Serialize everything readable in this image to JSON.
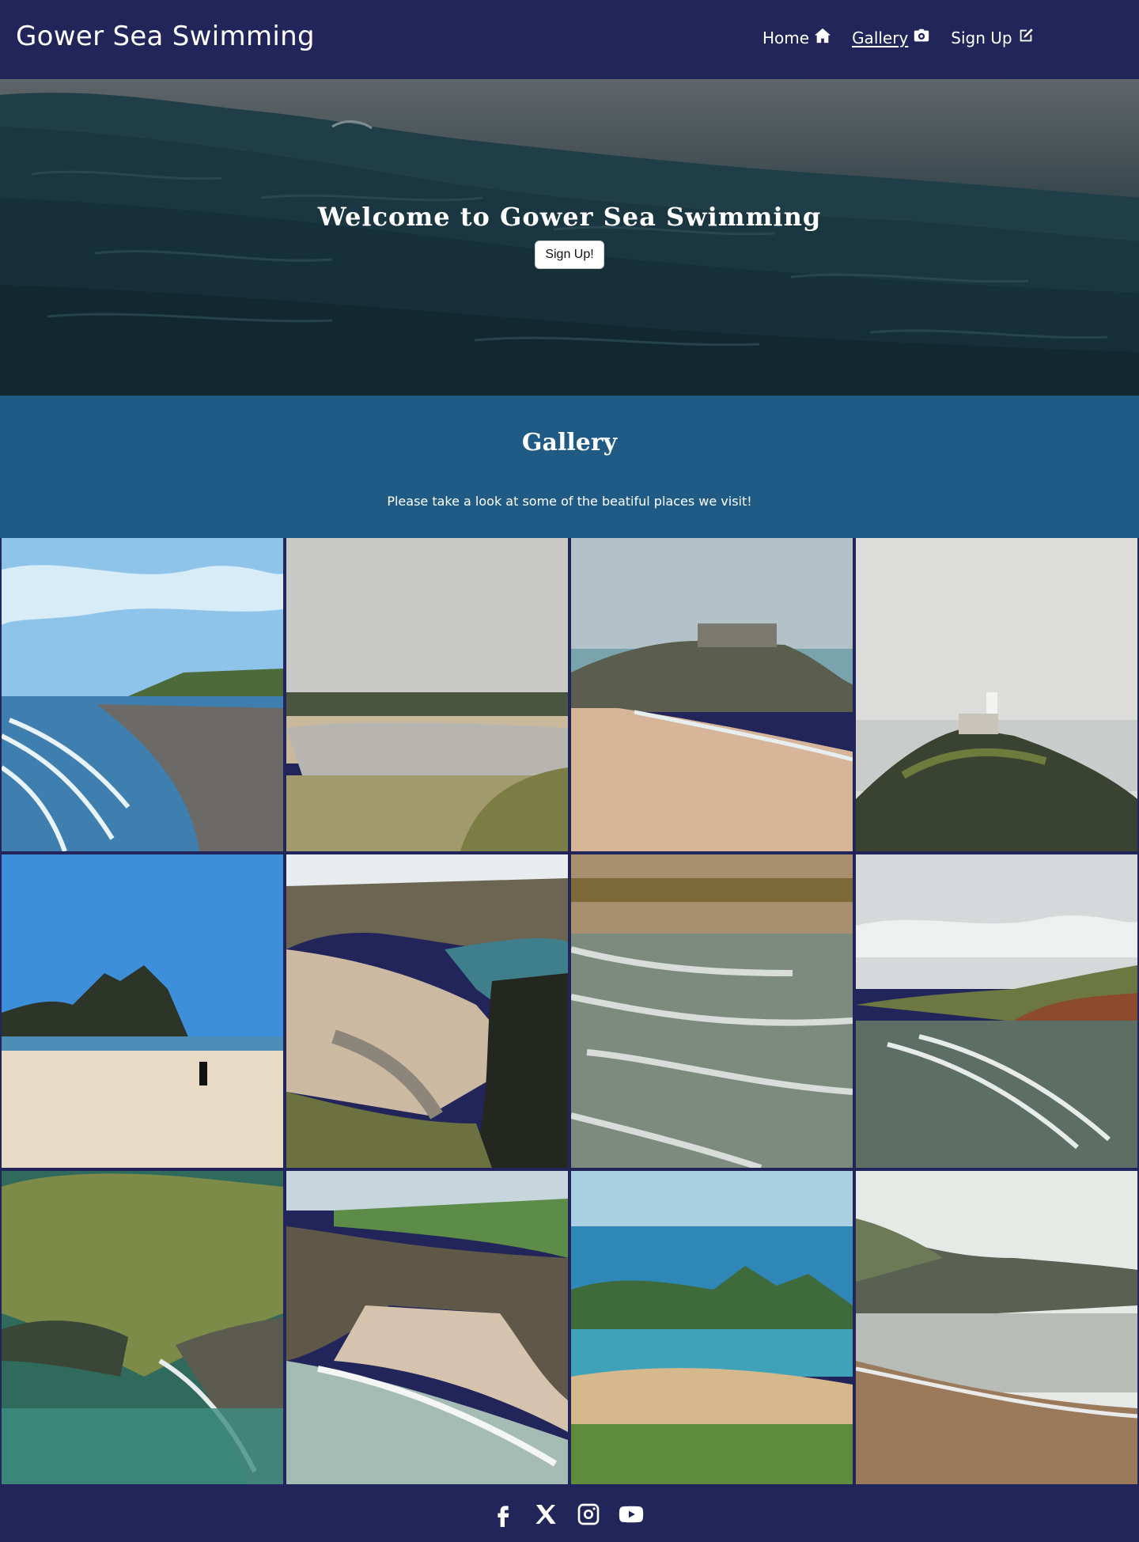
{
  "navbar": {
    "brand": "Gower Sea Swimming",
    "links": [
      {
        "label": "Home",
        "icon": "home-icon",
        "active": false
      },
      {
        "label": "Gallery",
        "icon": "camera-icon",
        "active": true
      },
      {
        "label": "Sign Up",
        "icon": "edit-icon",
        "active": false
      }
    ]
  },
  "hero": {
    "title": "Welcome to Gower Sea Swimming",
    "button_label": "Sign Up!"
  },
  "gallery": {
    "title": "Gallery",
    "subtitle": "Please take a look at some of the beatiful places we visit!"
  },
  "footer": {
    "social_icons": [
      "facebook-icon",
      "x-icon",
      "instagram-icon",
      "youtube-icon"
    ]
  },
  "colors": {
    "navbar_bg": "#22255a",
    "gallery_header_bg": "#1f5b85",
    "text": "#ffffff"
  }
}
